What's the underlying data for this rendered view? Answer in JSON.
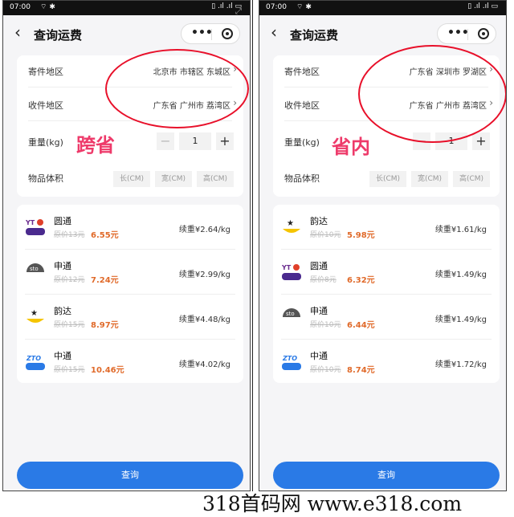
{
  "phones": [
    {
      "status": {
        "time": "07:00",
        "left_icons": "⌔ ✱",
        "right_icons": "▯ .ıl .ıl ▭"
      },
      "nav": {
        "title": "查询运费",
        "menu_icon": "more-dots-icon",
        "close_icon": "target-icon"
      },
      "form": {
        "sender_label": "寄件地区",
        "sender_value": "北京市 市辖区 东城区",
        "receiver_label": "收件地区",
        "receiver_value": "广东省 广州市 荔湾区",
        "weight_label": "重量(kg)",
        "weight_value": "1",
        "minus": "−",
        "plus": "+",
        "volume_label": "物品体积",
        "length": "长(CM)",
        "width": "宽(CM)",
        "height": "高(CM)"
      },
      "annotation": "跨省",
      "couriers": [
        {
          "name": "圆通",
          "logo": "yto",
          "original": "原价13元",
          "price": "6.55元",
          "continued": "续重¥2.64/kg"
        },
        {
          "name": "申通",
          "logo": "sto",
          "original": "原价12元",
          "price": "7.24元",
          "continued": "续重¥2.99/kg"
        },
        {
          "name": "韵达",
          "logo": "yunda",
          "original": "原价15元",
          "price": "8.97元",
          "continued": "续重¥4.48/kg"
        },
        {
          "name": "中通",
          "logo": "zto",
          "original": "原价15元",
          "price": "10.46元",
          "continued": "续重¥4.02/kg"
        }
      ],
      "submit": "查询"
    },
    {
      "status": {
        "time": "07:00",
        "left_icons": "⌔ ✱",
        "right_icons": "▯ .ıl .ıl ▭"
      },
      "nav": {
        "title": "查询运费",
        "menu_icon": "more-dots-icon",
        "close_icon": "target-icon"
      },
      "form": {
        "sender_label": "寄件地区",
        "sender_value": "广东省 深圳市 罗湖区",
        "receiver_label": "收件地区",
        "receiver_value": "广东省 广州市 荔湾区",
        "weight_label": "重量(kg)",
        "weight_value": "1",
        "minus": "−",
        "plus": "+",
        "volume_label": "物品体积",
        "length": "长(CM)",
        "width": "宽(CM)",
        "height": "高(CM)"
      },
      "annotation": "省内",
      "couriers": [
        {
          "name": "韵达",
          "logo": "yunda",
          "original": "原价10元",
          "price": "5.98元",
          "continued": "续重¥1.61/kg"
        },
        {
          "name": "圆通",
          "logo": "yto",
          "original": "原价8元",
          "price": "6.32元",
          "continued": "续重¥1.49/kg"
        },
        {
          "name": "申通",
          "logo": "sto",
          "original": "原价10元",
          "price": "6.44元",
          "continued": "续重¥1.49/kg"
        },
        {
          "name": "中通",
          "logo": "zto",
          "original": "原价10元",
          "price": "8.74元",
          "continued": "续重¥1.72/kg"
        }
      ],
      "submit": "查询"
    }
  ],
  "watermark": "318首码网  www.e318.com",
  "colors": {
    "accent": "#2a7ae6",
    "price": "#e06a2a",
    "annotation": "#ee3a6a",
    "circle": "#e8102a"
  }
}
